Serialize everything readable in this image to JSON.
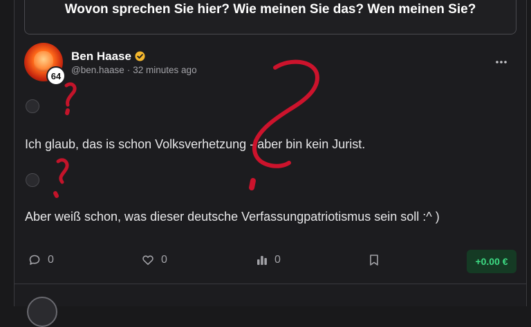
{
  "quoted_post": {
    "text": "Wovon sprechen Sie hier? Wie meinen Sie das? Wen meinen Sie?"
  },
  "post": {
    "author_name": "Ben Haase",
    "handle": "@ben.haase",
    "separator": "·",
    "time": "32 minutes ago",
    "level": "64",
    "paragraph_1": "Ich glaub, das is schon Volksverhetzung - aber bin kein Jurist.",
    "paragraph_2": "Aber weiß schon, was dieser deutsche Verfassungpatriotismus sein soll :^ )"
  },
  "actions": {
    "comments": "0",
    "likes": "0",
    "views": "0",
    "tip": "+0.00 €"
  },
  "icons": {
    "verified": "verified-badge-icon",
    "more": "more-options-icon",
    "comment": "comment-icon",
    "like": "heart-icon",
    "views": "bar-chart-icon",
    "bookmark": "bookmark-icon"
  },
  "colors": {
    "background": "#19191b",
    "verified": "#f5b82e",
    "tip_text": "#3ddc84",
    "tip_bg": "#153a24",
    "annotation": "#e0132d"
  }
}
